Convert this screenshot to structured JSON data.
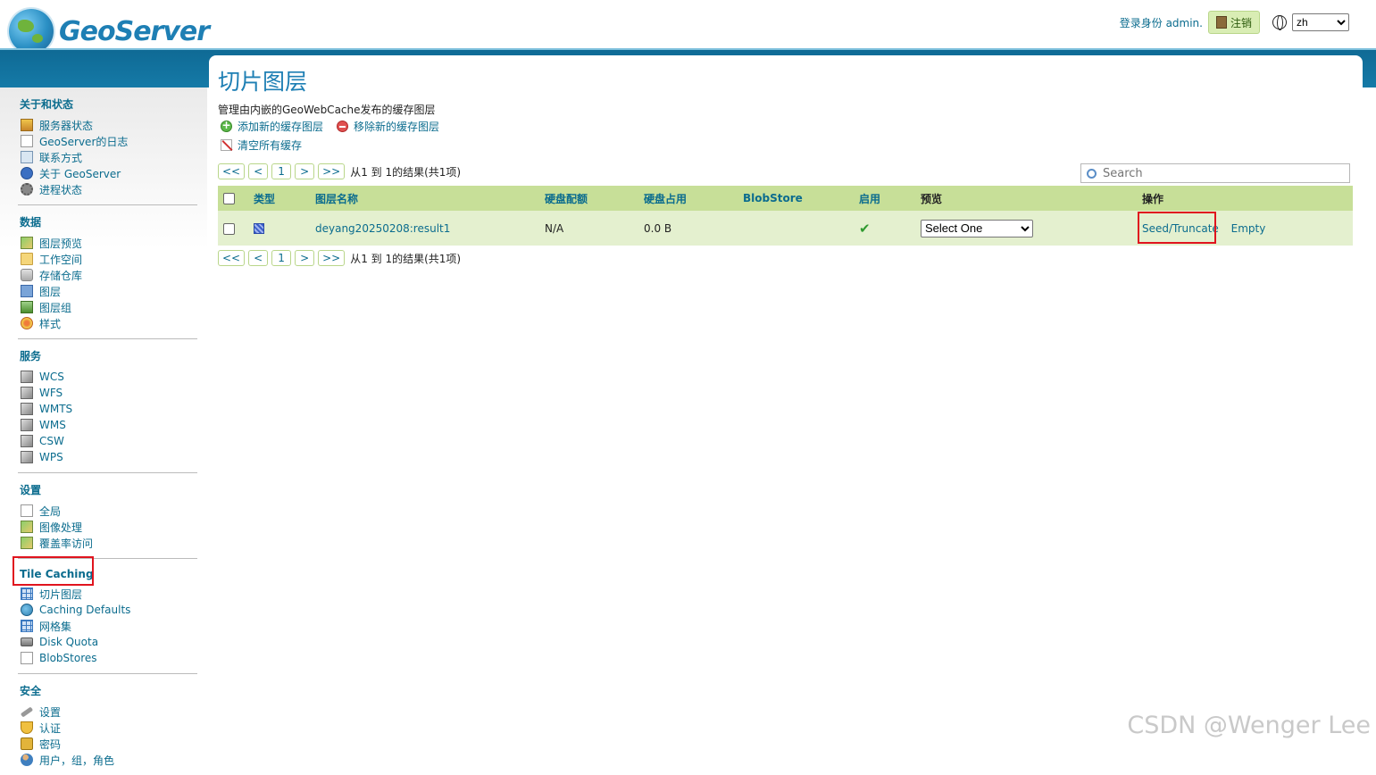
{
  "header": {
    "logo_text": "GeoServer",
    "logged_in_as": "登录身份 admin.",
    "logout_label": "注销",
    "language": "zh"
  },
  "sidebar": {
    "sections": [
      {
        "title": "关于和状态",
        "items": [
          {
            "label": "服务器状态",
            "icon": "server-status-icon"
          },
          {
            "label": "GeoServer的日志",
            "icon": "log-icon"
          },
          {
            "label": "联系方式",
            "icon": "contact-card-icon"
          },
          {
            "label": "关于 GeoServer",
            "icon": "info-icon"
          },
          {
            "label": "进程状态",
            "icon": "gear-icon"
          }
        ]
      },
      {
        "title": "数据",
        "items": [
          {
            "label": "图层预览",
            "icon": "map-preview-icon"
          },
          {
            "label": "工作空间",
            "icon": "folder-icon"
          },
          {
            "label": "存储仓库",
            "icon": "database-icon"
          },
          {
            "label": "图层",
            "icon": "layer-icon"
          },
          {
            "label": "图层组",
            "icon": "layer-group-icon"
          },
          {
            "label": "样式",
            "icon": "palette-icon"
          }
        ]
      },
      {
        "title": "服务",
        "items": [
          {
            "label": "WCS",
            "icon": "service-icon"
          },
          {
            "label": "WFS",
            "icon": "service-icon"
          },
          {
            "label": "WMTS",
            "icon": "service-icon"
          },
          {
            "label": "WMS",
            "icon": "service-icon"
          },
          {
            "label": "CSW",
            "icon": "service-icon"
          },
          {
            "label": "WPS",
            "icon": "service-icon"
          }
        ]
      },
      {
        "title": "设置",
        "items": [
          {
            "label": "全局",
            "icon": "settings-icon"
          },
          {
            "label": "图像处理",
            "icon": "image-processing-icon"
          },
          {
            "label": "覆盖率访问",
            "icon": "coverage-access-icon"
          }
        ]
      },
      {
        "title": "Tile Caching",
        "items": [
          {
            "label": "切片图层",
            "icon": "tile-layers-icon"
          },
          {
            "label": "Caching Defaults",
            "icon": "globe-icon"
          },
          {
            "label": "网格集",
            "icon": "gridset-icon"
          },
          {
            "label": "Disk Quota",
            "icon": "disk-icon"
          },
          {
            "label": "BlobStores",
            "icon": "blobstore-icon"
          }
        ]
      },
      {
        "title": "安全",
        "items": [
          {
            "label": "设置",
            "icon": "key-icon"
          },
          {
            "label": "认证",
            "icon": "shield-icon"
          },
          {
            "label": "密码",
            "icon": "lock-icon"
          },
          {
            "label": "用户，组，角色",
            "icon": "users-icon"
          }
        ]
      }
    ]
  },
  "main": {
    "title": "切片图层",
    "description": "管理由内嵌的GeoWebCache发布的缓存图层",
    "actions": {
      "add": "添加新的缓存图层",
      "remove": "移除新的缓存图层",
      "clear": "清空所有缓存"
    },
    "pager": {
      "first": "<<",
      "prev": "<",
      "page": "1",
      "next": ">",
      "last": ">>",
      "summary": "从1 到 1的结果(共1项)"
    },
    "search_placeholder": "Search",
    "table": {
      "headers": {
        "type": "类型",
        "name": "图层名称",
        "quota": "硬盘配额",
        "usage": "硬盘占用",
        "blobstore": "BlobStore",
        "enabled": "启用",
        "preview": "预览",
        "actions": "操作"
      },
      "rows": [
        {
          "name": "deyang20250208:result1",
          "quota": "N/A",
          "usage": "0.0 B",
          "blobstore": "",
          "enabled": "✔",
          "preview": "Select One",
          "seed": "Seed/Truncate",
          "empty": "Empty"
        }
      ]
    }
  },
  "watermark": "CSDN @Wenger Lee",
  "colors": {
    "accent": "#0b6c8e",
    "table_header": "#c7df98",
    "table_row": "#e4f0cf",
    "highlight": "#e0141e"
  }
}
